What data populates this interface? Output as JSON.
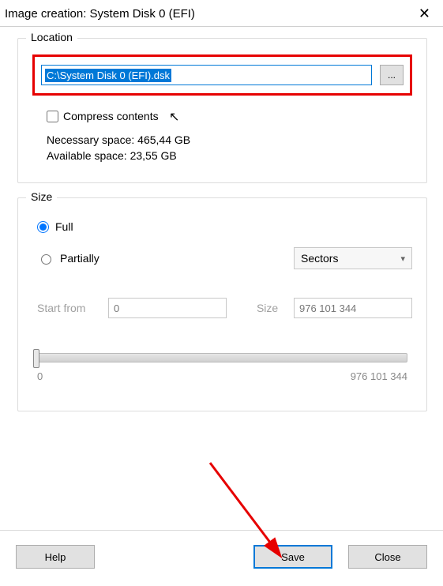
{
  "window": {
    "title": "Image creation: System Disk 0 (EFI)"
  },
  "location": {
    "legend": "Location",
    "path": "C:\\System Disk 0 (EFI).dsk",
    "browse": "...",
    "compress_label": "Compress contents",
    "necessary_label": "Necessary space:",
    "necessary_value": "465,44 GB",
    "available_label": "Available space:",
    "available_value": "23,55 GB"
  },
  "size_group": {
    "legend": "Size",
    "full_label": "Full",
    "partial_label": "Partially",
    "unit_selected": "Sectors",
    "start_label": "Start from",
    "start_value": "0",
    "size_label": "Size",
    "size_value": "976 101 344",
    "slider_min": "0",
    "slider_max": "976 101 344"
  },
  "buttons": {
    "help": "Help",
    "save": "Save",
    "close": "Close"
  }
}
